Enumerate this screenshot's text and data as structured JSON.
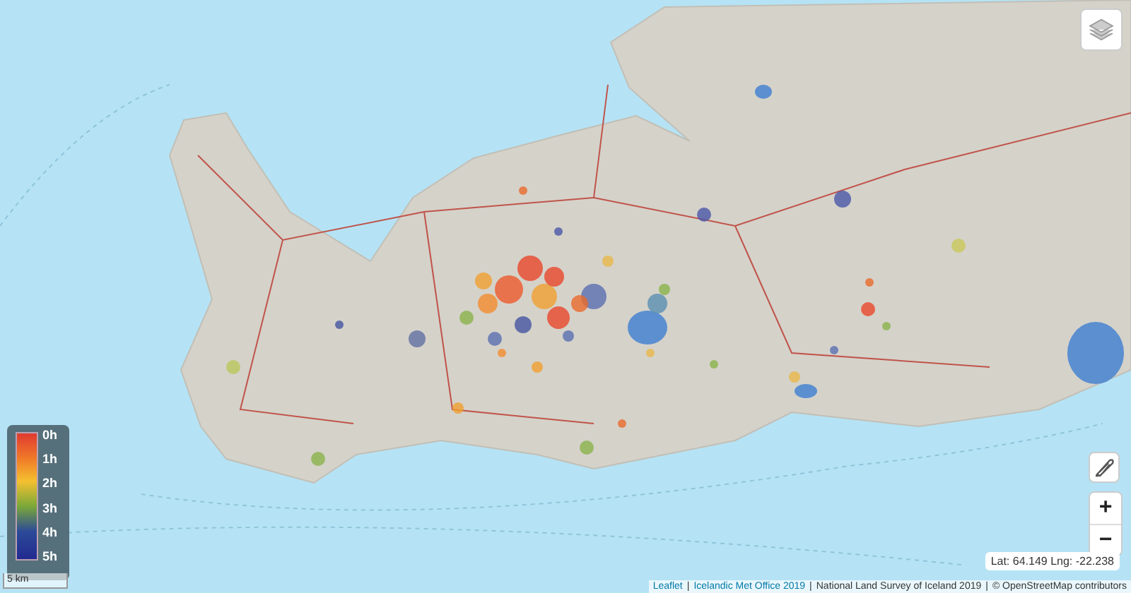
{
  "legend": {
    "labels": [
      "0h",
      "1h",
      "2h",
      "3h",
      "4h",
      "5h"
    ]
  },
  "scale": {
    "label": "5 km"
  },
  "zoom": {
    "in": "+",
    "out": "−"
  },
  "coordinates": "Lat: 64.149 Lng: -22.238",
  "attribution": [
    {
      "text": "Leaflet",
      "kind": "link"
    },
    {
      "text": "|",
      "kind": "separator"
    },
    {
      "text": "Icelandic Met Office 2019",
      "kind": "link"
    },
    {
      "text": "|",
      "kind": "separator"
    },
    {
      "text": "National Land Survey of Iceland 2019",
      "kind": "text"
    },
    {
      "text": "|",
      "kind": "separator"
    },
    {
      "text": "© OpenStreetMap contributors",
      "kind": "text"
    }
  ]
}
